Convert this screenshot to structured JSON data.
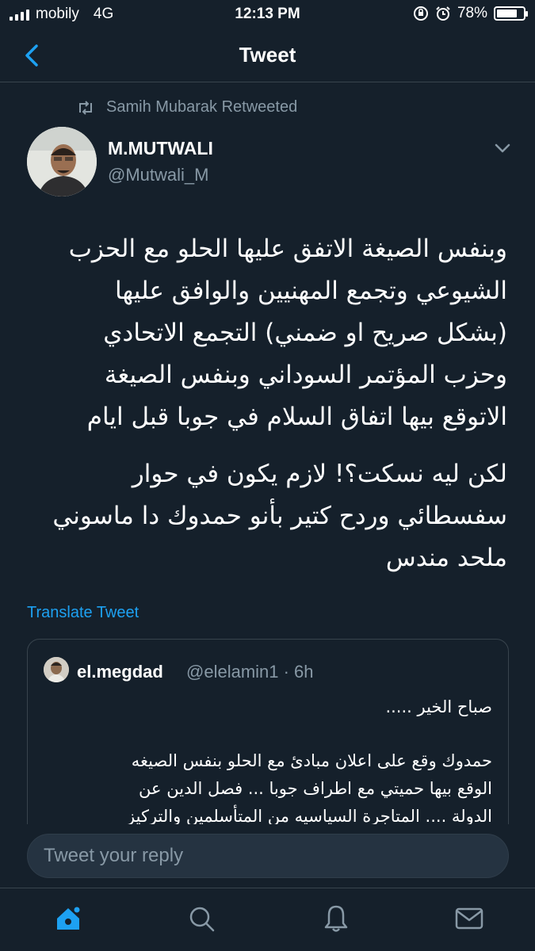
{
  "status_bar": {
    "carrier": "mobily",
    "network": "4G",
    "time": "12:13 PM",
    "battery": "78%",
    "battery_level": 0.78
  },
  "header": {
    "title": "Tweet"
  },
  "retweet": {
    "text": "Samih Mubarak Retweeted"
  },
  "tweet": {
    "author_name": "M.MUTWALI",
    "author_handle": "@Mutwali_M",
    "paragraph1": "وبنفس الصيغة الاتفق عليها الحلو مع الحزب\nالشيوعي وتجمع المهنيين والوافق عليها\n(بشكل صريح او ضمني) التجمع الاتحادي\nوحزب المؤتمر السوداني وبنفس الصيغة\nالاتوقع بيها اتفاق السلام في جوبا قبل ايام",
    "paragraph2": "لكن ليه نسكت؟! لازم يكون في حوار\nسفسطائي وردح كتير بأنو حمدوك دا ماسوني\nملحد مندس",
    "translate_label": "Translate Tweet"
  },
  "quoted_tweet": {
    "author_name": "el.megdad",
    "meta": "@elelamin1 · 6h",
    "line1": "صباح الخير .....",
    "line2": "حمدوك وقع على اعلان مبادئ مع الحلو بنفس الصيغه\nالوقع بيها حميتي مع اطراف جوبا ... فصل الدين عن\nالدولة .... المتاجرة السياسيه من المتأسلمين والتركيز"
  },
  "reply": {
    "placeholder": "Tweet your reply"
  },
  "colors": {
    "background": "#15202b",
    "accent": "#1da1f2",
    "secondary_text": "#8899a6",
    "border": "#38444d"
  },
  "icons": {
    "back": "chevron-left-icon",
    "retweet": "retweet-icon",
    "more": "chevron-down-icon",
    "tabs": [
      "home-icon",
      "search-icon",
      "notifications-icon",
      "messages-icon"
    ]
  }
}
